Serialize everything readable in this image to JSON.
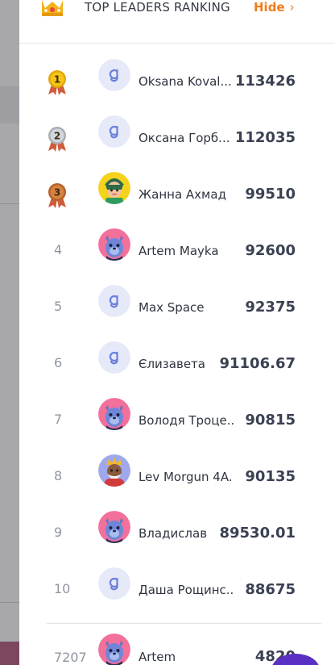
{
  "header": {
    "title": "TOP LEADERS RANKING",
    "hide_label": "Hide",
    "hide_chevron": "›"
  },
  "rows": [
    {
      "rank": "1",
      "medal": "gold",
      "avatar": "g-logo",
      "name": "Oksana Koval...",
      "score": "113426"
    },
    {
      "rank": "2",
      "medal": "silver",
      "avatar": "g-logo",
      "name": "Оксана Горб...",
      "score": "112035"
    },
    {
      "rank": "3",
      "medal": "bronze",
      "avatar": "elf",
      "name": "Жанна Ахмад",
      "score": "99510"
    },
    {
      "rank": "4",
      "avatar": "wolf",
      "name": "Artem Mayka",
      "score": "92600"
    },
    {
      "rank": "5",
      "avatar": "g-logo",
      "name": "Max Space",
      "score": "92375"
    },
    {
      "rank": "6",
      "avatar": "g-logo",
      "name": "Єлизавета",
      "score": "91106.67"
    },
    {
      "rank": "7",
      "avatar": "wolf",
      "name": "Володя Троце...",
      "score": "90815"
    },
    {
      "rank": "8",
      "avatar": "king",
      "name": "Lev Morgun 4A...",
      "score": "90135"
    },
    {
      "rank": "9",
      "avatar": "wolf",
      "name": "Владислав",
      "score": "89530.01"
    },
    {
      "rank": "10",
      "avatar": "g-logo",
      "name": "Даша Рощинс...",
      "score": "88675"
    }
  ],
  "current_user": {
    "rank": "7207",
    "avatar": "wolf",
    "name": "Artem",
    "score": "4820"
  },
  "colors": {
    "accent": "#f07c1a",
    "gold": "#f5c518",
    "silver": "#c9ccd3",
    "bronze": "#c8743a",
    "g_logo_bg": "#e5e9f8"
  }
}
